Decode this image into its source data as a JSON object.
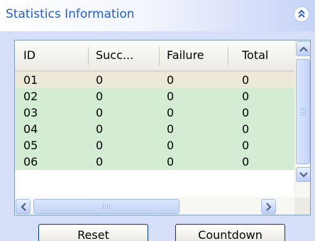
{
  "panel": {
    "title": "Statistics Information"
  },
  "grid": {
    "columns": [
      "ID",
      "Succ...",
      "Failure",
      "Total"
    ],
    "rows": [
      {
        "id": "01",
        "success": "0",
        "failure": "0",
        "total": "0"
      },
      {
        "id": "02",
        "success": "0",
        "failure": "0",
        "total": "0"
      },
      {
        "id": "03",
        "success": "0",
        "failure": "0",
        "total": "0"
      },
      {
        "id": "04",
        "success": "0",
        "failure": "0",
        "total": "0"
      },
      {
        "id": "05",
        "success": "0",
        "failure": "0",
        "total": "0"
      },
      {
        "id": "06",
        "success": "0",
        "failure": "0",
        "total": "0"
      }
    ],
    "row_colors": {
      "selected": "#ece9d8",
      "normal": "#d4ecd4"
    }
  },
  "buttons": {
    "reset": "Reset",
    "countdown": "Countdown"
  },
  "colors": {
    "title": "#215dc6",
    "panel_bg": "#d6dff7"
  }
}
